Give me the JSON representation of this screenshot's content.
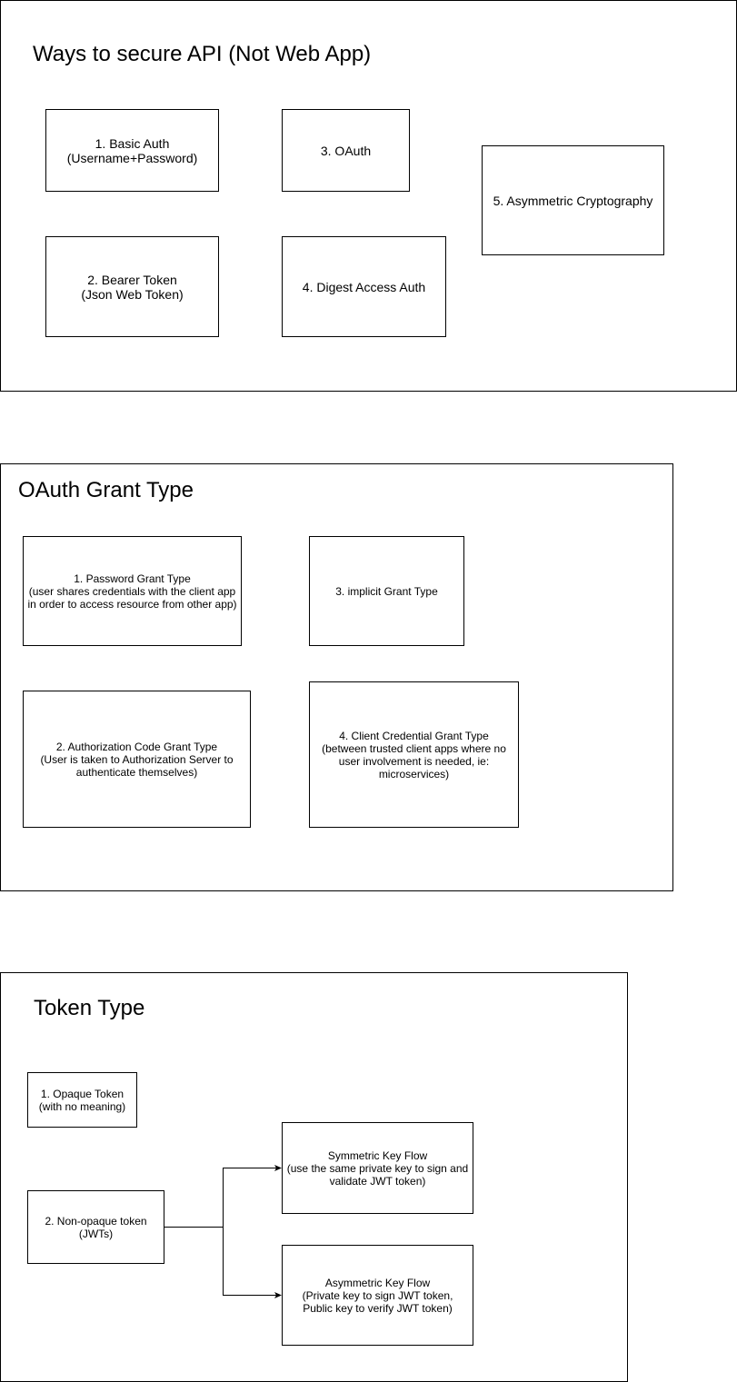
{
  "secure_api": {
    "title": "Ways to secure API (Not Web App)",
    "items": [
      "1. Basic Auth\n(Username+Password)",
      "2. Bearer Token\n(Json Web Token)",
      "3. OAuth",
      "4. Digest Access Auth",
      "5. Asymmetric Cryptography"
    ]
  },
  "oauth_grant": {
    "title": "OAuth Grant Type",
    "items": [
      "1. Password Grant Type\n(user shares credentials with the client app\nin order to access resource from other app)",
      "2. Authorization Code Grant Type\n(User is taken to Authorization Server to\nauthenticate themselves)",
      "3. implicit Grant Type",
      "4. Client Credential Grant Type\n(between trusted client apps where no\nuser involvement is needed, ie:\nmicroservices)"
    ]
  },
  "token_type": {
    "title": "Token Type",
    "items": [
      "1. Opaque Token\n(with no meaning)",
      "2. Non-opaque token\n(JWTs)",
      "Symmetric Key Flow\n(use the same private key to sign and\nvalidate JWT token)",
      "Asymmetric Key Flow\n(Private key to sign JWT token,\nPublic key to verify JWT token)"
    ]
  },
  "colors": {
    "stroke": "#000000",
    "background": "#ffffff"
  }
}
